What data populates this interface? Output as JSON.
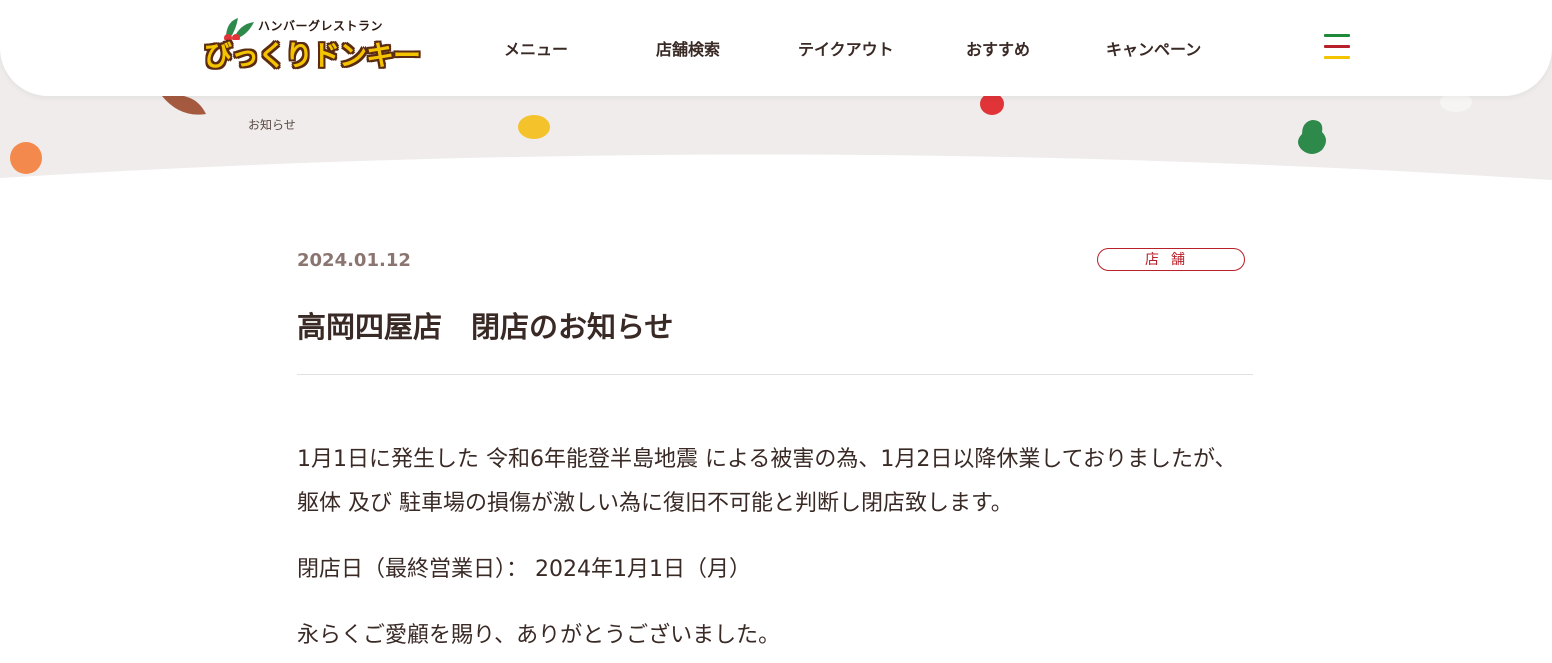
{
  "header": {
    "logo": {
      "tagline": "ハンバーグレストラン",
      "name": "びっくりドンキー"
    },
    "nav": [
      {
        "label": "メニュー"
      },
      {
        "label": "店舗検索"
      },
      {
        "label": "テイクアウト"
      },
      {
        "label": "おすすめ"
      },
      {
        "label": "キャンペーン"
      }
    ],
    "menu_icon": "hamburger-menu-icon"
  },
  "breadcrumb": "お知らせ",
  "article": {
    "date": "2024.01.12",
    "category": "店舗",
    "title": "高岡四屋店　閉店のお知らせ",
    "paragraphs": [
      "1月1日に発生した 令和6年能登半島地震 による被害の為、1月2日以降休業しておりましたが、躯体 及び 駐車場の損傷が激しい為に復旧不可能と判断し閉店致します。",
      "閉店日（最終営業日）： 2024年1月1日（月）",
      "永らくご愛顧を賜り、ありがとうございました。"
    ]
  },
  "colors": {
    "accent_red": "#b8202a",
    "logo_yellow": "#f4c400",
    "menu_green": "#1e8a3a",
    "menu_red": "#b8202a",
    "menu_yellow": "#f4c400",
    "band_bg": "#efeceb"
  }
}
